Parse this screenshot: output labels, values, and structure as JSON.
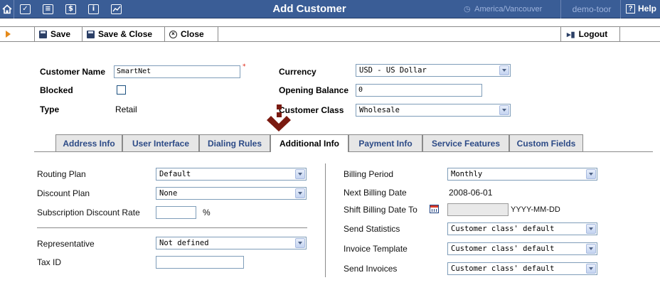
{
  "window": {
    "title": "Add Customer",
    "timezone": "America/Vancouver",
    "user": "demo-toor",
    "help_label": "Help",
    "help_icon": "?"
  },
  "toolbar": {
    "save_label": "Save",
    "save_close_label": "Save & Close",
    "close_label": "Close",
    "logout_label": "Logout"
  },
  "customer": {
    "name_label": "Customer Name",
    "name_value": "SmartNet",
    "blocked_label": "Blocked",
    "type_label": "Type",
    "type_value": "Retail",
    "currency_label": "Currency",
    "currency_value": "USD - US Dollar",
    "opening_balance_label": "Opening Balance",
    "opening_balance_value": "0",
    "customer_class_label": "Customer Class",
    "customer_class_value": "Wholesale",
    "required_mark": "*"
  },
  "tabs": [
    {
      "label": "Address Info"
    },
    {
      "label": "User Interface"
    },
    {
      "label": "Dialing Rules"
    },
    {
      "label": "Additional Info"
    },
    {
      "label": "Payment Info"
    },
    {
      "label": "Service Features"
    },
    {
      "label": "Custom Fields"
    }
  ],
  "additional_info": {
    "routing_plan_label": "Routing Plan",
    "routing_plan_value": "Default",
    "discount_plan_label": "Discount Plan",
    "discount_plan_value": "None",
    "subscription_discount_label": "Subscription Discount Rate",
    "subscription_discount_value": "",
    "percent_sign": "%",
    "representative_label": "Representative",
    "representative_value": "Not defined",
    "tax_id_label": "Tax ID",
    "tax_id_value": "",
    "billing_period_label": "Billing Period",
    "billing_period_value": "Monthly",
    "next_billing_date_label": "Next Billing Date",
    "next_billing_date_value": "2008-06-01",
    "shift_billing_date_label": "Shift Billing Date To",
    "shift_billing_date_value": "",
    "date_format_hint": "YYYY-MM-DD",
    "send_statistics_label": "Send Statistics",
    "send_statistics_value": "Customer class' default",
    "invoice_template_label": "Invoice Template",
    "invoice_template_value": "Customer class' default",
    "send_invoices_label": "Send Invoices",
    "send_invoices_value": "Customer class' default"
  },
  "colors": {
    "topbar": "#3a5d96",
    "tab_text": "#2c4a86",
    "pointer": "#7a1a10",
    "toolbar_arrow": "#e58a1a"
  }
}
